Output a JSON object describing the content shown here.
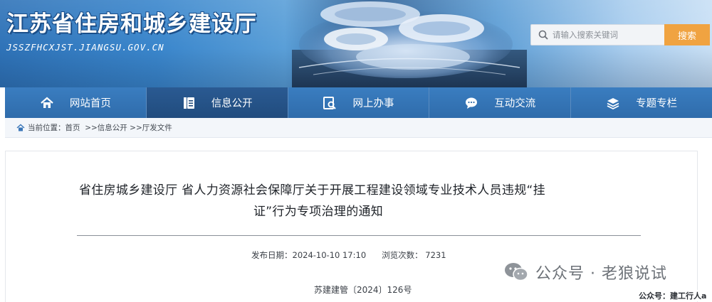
{
  "header": {
    "site_title": "江苏省住房和城乡建设厅",
    "site_domain": "JSSZFHCXJST.JIANGSU.GOV.CN",
    "search_placeholder": "请输入搜索关键词",
    "search_button": "搜索",
    "search_icon": "magnifier-icon"
  },
  "nav": {
    "items": [
      {
        "label": "网站首页",
        "icon": "home-icon",
        "active": false
      },
      {
        "label": "信息公开",
        "icon": "document-icon",
        "active": true
      },
      {
        "label": "网上办事",
        "icon": "online-service-icon",
        "active": false
      },
      {
        "label": "互动交流",
        "icon": "chat-icon",
        "active": false
      },
      {
        "label": "专题专栏",
        "icon": "layers-icon",
        "active": false
      }
    ]
  },
  "breadcrumb": {
    "prefix": "当前位置：",
    "items": [
      "首页",
      ">>信息公开",
      ">>厅发文件"
    ]
  },
  "article": {
    "title_line1": "省住房城乡建设厅 省人力资源社会保障厅关于开展工程建设领域专业技术人员违规“挂",
    "title_line2": "证”行为专项治理的通知",
    "publish_label": "发布日期：",
    "publish_date": "2024-10-10 17:10",
    "views_label": "浏览次数：",
    "views": "7231",
    "doc_number": "苏建建管〔2024〕126号"
  },
  "watermark": {
    "text": "公众号 · 老狼说试",
    "caption": "公众号：建工行人a"
  },
  "colors": {
    "nav_bg": "#2e6aa8",
    "nav_active": "#214c7e",
    "search_button": "#f0a341",
    "breadcrumb_bg": "#f3f6fa"
  }
}
